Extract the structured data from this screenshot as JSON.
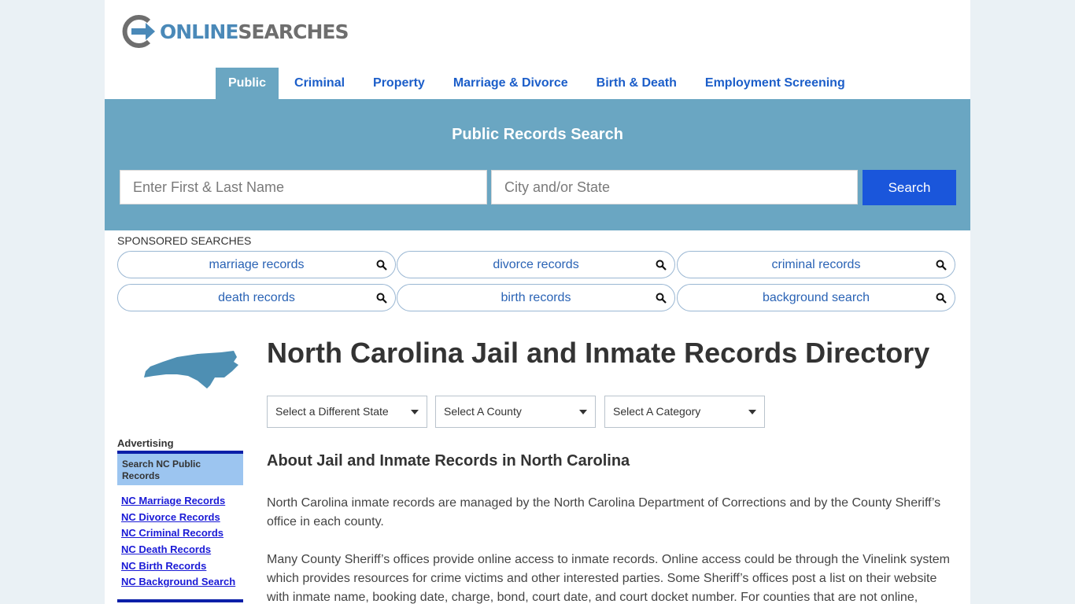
{
  "header": {
    "logo_part1": "ONLINE",
    "logo_part2": "SEARCHES"
  },
  "nav": {
    "items": [
      {
        "label": "Public",
        "active": true
      },
      {
        "label": "Criminal"
      },
      {
        "label": "Property"
      },
      {
        "label": "Marriage & Divorce"
      },
      {
        "label": "Birth & Death"
      },
      {
        "label": "Employment Screening"
      }
    ]
  },
  "search": {
    "title": "Public Records Search",
    "name_placeholder": "Enter First & Last Name",
    "city_placeholder": "City and/or State",
    "button_label": "Search"
  },
  "sponsored": {
    "label": "SPONSORED SEARCHES",
    "items": [
      "marriage records",
      "divorce records",
      "criminal records",
      "death records",
      "birth records",
      "background search"
    ]
  },
  "sidebar": {
    "advertising_label": "Advertising",
    "box_title": "Search NC Public Records",
    "links": [
      "NC Marriage Records",
      "NC Divorce Records",
      "NC Criminal Records",
      "NC Death Records",
      "NC Birth Records",
      "NC Background Search"
    ]
  },
  "main": {
    "title": "North Carolina Jail and Inmate Records Directory",
    "selects": [
      "Select a Different State",
      "Select A County",
      "Select A Category"
    ],
    "subtitle": "About Jail and Inmate Records in North Carolina",
    "paragraphs": [
      "North Carolina inmate records are managed by the North Carolina Department of Corrections and by the County Sheriff’s office in each county.",
      "Many County Sheriff’s offices provide online access to inmate records. Online access could be through the Vinelink system which provides resources for crime victims and other interested parties. Some Sheriff’s offices post a list on their website with inmate name, booking date, charge, bond, court date, and court docket number. For counties that are not online,"
    ]
  },
  "colors": {
    "banner": "#6aa6c2",
    "nav_link": "#1c5ec9",
    "search_button": "#1a56db",
    "logo_blue": "#4a89b8",
    "logo_gray": "#6e6e6e"
  }
}
